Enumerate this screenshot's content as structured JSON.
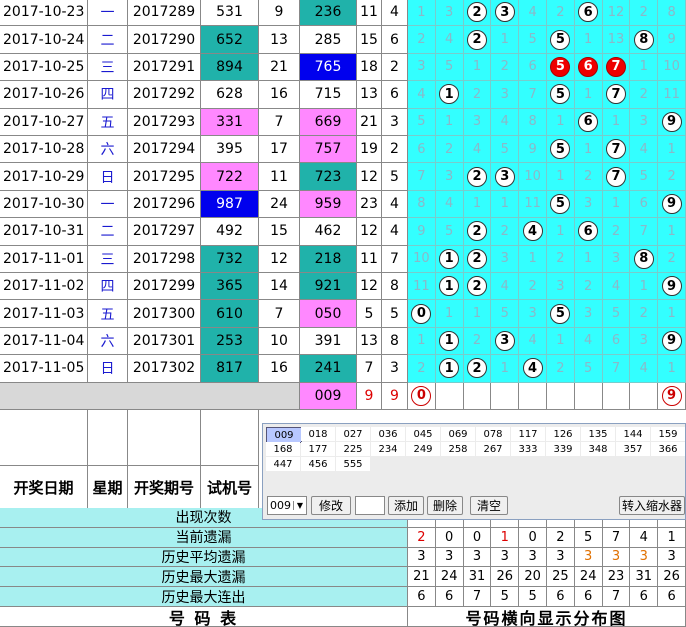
{
  "draws": [
    {
      "date": "2017-10-23",
      "weekday": "一",
      "issue": "2017289",
      "trial": "531",
      "span": "9",
      "result": "236",
      "sum": "11",
      "k": "4",
      "trial_hl": "",
      "result_hl": "teal",
      "dist": [
        "1",
        "3",
        "2",
        "3",
        "4",
        "2",
        "6",
        "12",
        "2",
        "8"
      ],
      "balls": [
        2,
        3,
        6
      ]
    },
    {
      "date": "2017-10-24",
      "weekday": "二",
      "issue": "2017290",
      "trial": "652",
      "span": "13",
      "result": "285",
      "sum": "15",
      "k": "6",
      "trial_hl": "teal",
      "result_hl": "",
      "dist": [
        "2",
        "4",
        "2",
        "1",
        "5",
        "5",
        "1",
        "13",
        "8",
        "9"
      ],
      "balls": [
        2,
        5,
        8
      ]
    },
    {
      "date": "2017-10-25",
      "weekday": "三",
      "issue": "2017291",
      "trial": "894",
      "span": "21",
      "result": "765",
      "sum": "18",
      "k": "2",
      "trial_hl": "teal",
      "result_hl": "blue",
      "dist": [
        "3",
        "5",
        "1",
        "2",
        "6",
        "5",
        "6",
        "7",
        "1",
        "10"
      ],
      "balls": [
        5,
        6,
        7
      ],
      "red": true
    },
    {
      "date": "2017-10-26",
      "weekday": "四",
      "issue": "2017292",
      "trial": "628",
      "span": "16",
      "result": "715",
      "sum": "13",
      "k": "6",
      "trial_hl": "",
      "result_hl": "",
      "dist": [
        "4",
        "1",
        "2",
        "3",
        "7",
        "5",
        "1",
        "7",
        "2",
        "11"
      ],
      "balls": [
        1,
        5,
        7
      ]
    },
    {
      "date": "2017-10-27",
      "weekday": "五",
      "issue": "2017293",
      "trial": "331",
      "span": "7",
      "result": "669",
      "sum": "21",
      "k": "3",
      "trial_hl": "pink",
      "result_hl": "pink",
      "dist": [
        "5",
        "1",
        "3",
        "4",
        "8",
        "1",
        "6",
        "1",
        "3",
        "9"
      ],
      "balls": [
        6,
        9
      ]
    },
    {
      "date": "2017-10-28",
      "weekday": "六",
      "issue": "2017294",
      "trial": "395",
      "span": "17",
      "result": "757",
      "sum": "19",
      "k": "2",
      "trial_hl": "",
      "result_hl": "pink",
      "dist": [
        "6",
        "2",
        "4",
        "5",
        "9",
        "5",
        "1",
        "7",
        "4",
        "1"
      ],
      "balls": [
        5,
        7
      ]
    },
    {
      "date": "2017-10-29",
      "weekday": "日",
      "issue": "2017295",
      "trial": "722",
      "span": "11",
      "result": "723",
      "sum": "12",
      "k": "5",
      "trial_hl": "pink",
      "result_hl": "teal",
      "dist": [
        "7",
        "3",
        "2",
        "3",
        "10",
        "1",
        "2",
        "7",
        "5",
        "2"
      ],
      "balls": [
        2,
        3,
        7
      ]
    },
    {
      "date": "2017-10-30",
      "weekday": "一",
      "issue": "2017296",
      "trial": "987",
      "span": "24",
      "result": "959",
      "sum": "23",
      "k": "4",
      "trial_hl": "blue",
      "result_hl": "pink",
      "dist": [
        "8",
        "4",
        "1",
        "1",
        "11",
        "5",
        "3",
        "1",
        "6",
        "9"
      ],
      "balls": [
        5,
        9
      ]
    },
    {
      "date": "2017-10-31",
      "weekday": "二",
      "issue": "2017297",
      "trial": "492",
      "span": "15",
      "result": "462",
      "sum": "12",
      "k": "4",
      "trial_hl": "",
      "result_hl": "",
      "dist": [
        "9",
        "5",
        "2",
        "2",
        "4",
        "1",
        "6",
        "2",
        "7",
        "1"
      ],
      "balls": [
        2,
        4,
        6
      ]
    },
    {
      "date": "2017-11-01",
      "weekday": "三",
      "issue": "2017298",
      "trial": "732",
      "span": "12",
      "result": "218",
      "sum": "11",
      "k": "7",
      "trial_hl": "teal",
      "result_hl": "teal",
      "dist": [
        "10",
        "1",
        "2",
        "3",
        "1",
        "2",
        "1",
        "3",
        "8",
        "2"
      ],
      "balls": [
        1,
        2,
        8
      ]
    },
    {
      "date": "2017-11-02",
      "weekday": "四",
      "issue": "2017299",
      "trial": "365",
      "span": "14",
      "result": "921",
      "sum": "12",
      "k": "8",
      "trial_hl": "teal",
      "result_hl": "teal",
      "dist": [
        "11",
        "1",
        "2",
        "4",
        "2",
        "3",
        "2",
        "4",
        "1",
        "9"
      ],
      "balls": [
        1,
        2,
        9
      ]
    },
    {
      "date": "2017-11-03",
      "weekday": "五",
      "issue": "2017300",
      "trial": "610",
      "span": "7",
      "result": "050",
      "sum": "5",
      "k": "5",
      "trial_hl": "teal",
      "result_hl": "pink",
      "dist": [
        "0",
        "1",
        "1",
        "5",
        "3",
        "5",
        "3",
        "5",
        "2",
        "1"
      ],
      "balls": [
        0,
        5
      ]
    },
    {
      "date": "2017-11-04",
      "weekday": "六",
      "issue": "2017301",
      "trial": "253",
      "span": "10",
      "result": "391",
      "sum": "13",
      "k": "8",
      "trial_hl": "teal",
      "result_hl": "",
      "dist": [
        "1",
        "1",
        "2",
        "3",
        "4",
        "1",
        "4",
        "6",
        "3",
        "9"
      ],
      "balls": [
        1,
        3,
        9
      ]
    },
    {
      "date": "2017-11-05",
      "weekday": "日",
      "issue": "2017302",
      "trial": "817",
      "span": "16",
      "result": "241",
      "sum": "7",
      "k": "3",
      "trial_hl": "teal",
      "result_hl": "teal",
      "dist": [
        "2",
        "1",
        "2",
        "1",
        "4",
        "2",
        "5",
        "7",
        "4",
        "1"
      ],
      "balls": [
        1,
        2,
        4
      ]
    }
  ],
  "forecast": {
    "result": "009",
    "sum": "9",
    "k": "9",
    "balls": [
      {
        "col": 0,
        "label": "0"
      },
      {
        "col": 9,
        "label": "9"
      }
    ]
  },
  "headers": {
    "date": "开奖日期",
    "weekday": "星期",
    "issue": "开奖期号",
    "trial": "试机号"
  },
  "stats": [
    {
      "label": "出现次数",
      "values": [
        "",
        "",
        "",
        "",
        "",
        "",
        "",
        "",
        "",
        ""
      ]
    },
    {
      "label": "当前遗漏",
      "values": [
        "2",
        "0",
        "0",
        "1",
        "0",
        "2",
        "5",
        "7",
        "4",
        "1"
      ],
      "colors": [
        "red",
        "",
        "",
        "red",
        "",
        "",
        "",
        "",
        "",
        ""
      ]
    },
    {
      "label": "历史平均遗漏",
      "values": [
        "3",
        "3",
        "3",
        "3",
        "3",
        "3",
        "3",
        "3",
        "3",
        "3"
      ],
      "colors": [
        "",
        "",
        "",
        "",
        "",
        "",
        "orange",
        "orange",
        "orange",
        ""
      ]
    },
    {
      "label": "历史最大遗漏",
      "values": [
        "21",
        "24",
        "31",
        "26",
        "20",
        "25",
        "24",
        "23",
        "31",
        "26"
      ]
    },
    {
      "label": "历史最大连出",
      "values": [
        "6",
        "6",
        "7",
        "5",
        "5",
        "6",
        "6",
        "7",
        "6",
        "6"
      ]
    }
  ],
  "footer": {
    "left": "号  码  表",
    "right": "号码横向显示分布图"
  },
  "panel": {
    "numbers": [
      "009",
      "018",
      "027",
      "036",
      "045",
      "069",
      "078",
      "117",
      "126",
      "135",
      "144",
      "159",
      "168",
      "177",
      "225",
      "234",
      "249",
      "258",
      "267",
      "333",
      "339",
      "348",
      "357",
      "366",
      "447",
      "456",
      "555"
    ],
    "selected_value": "009",
    "modify_label": "修改",
    "add_label": "添加",
    "delete_label": "删除",
    "clear_label": "清空",
    "shrink_label": "转入缩水器"
  }
}
